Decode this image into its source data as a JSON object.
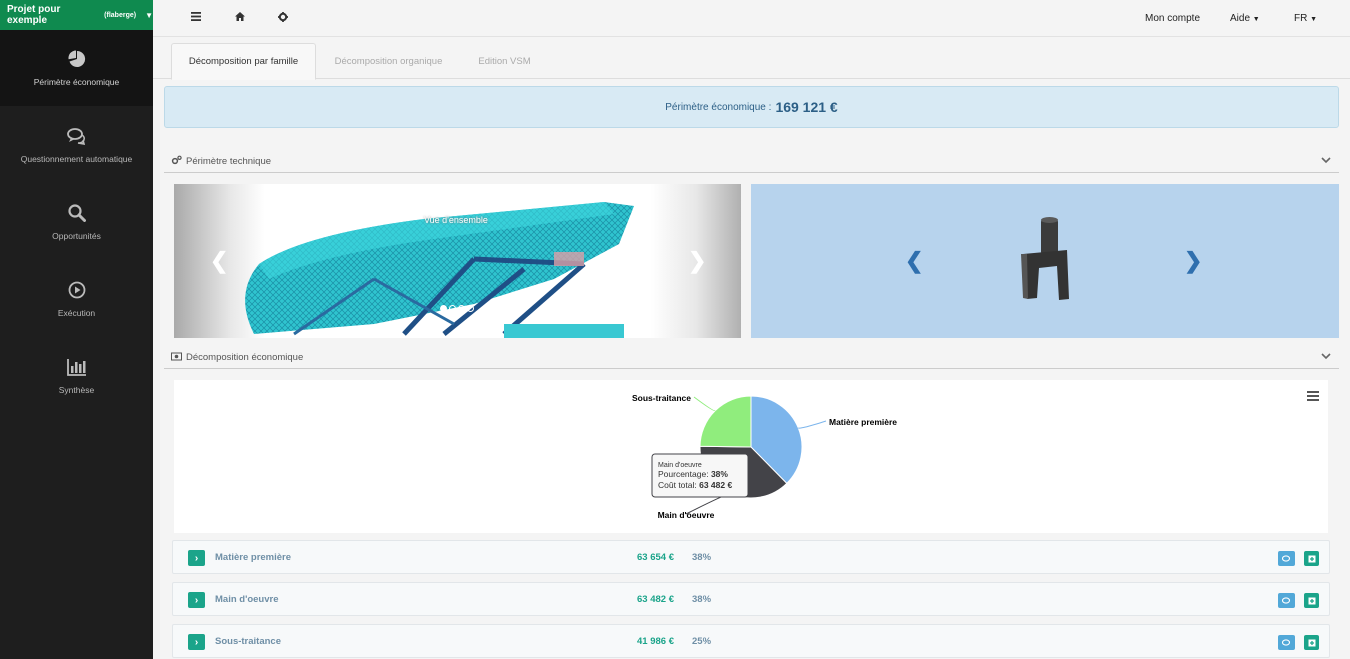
{
  "sidebar": {
    "project_name": "Projet pour exemple",
    "project_tag": "(flaberge)",
    "items": [
      {
        "label": "Périmètre économique",
        "icon": "pie-chart-icon",
        "active": true
      },
      {
        "label": "Questionnement automatique",
        "icon": "comments-icon",
        "active": false
      },
      {
        "label": "Opportunités",
        "icon": "search-icon",
        "active": false
      },
      {
        "label": "Exécution",
        "icon": "play-circle-icon",
        "active": false
      },
      {
        "label": "Synthèse",
        "icon": "bar-chart-icon",
        "active": false
      }
    ]
  },
  "topbar": {
    "menu_icon": "menu-icon",
    "home_icon": "home-icon",
    "settings_icon": "gear-icon",
    "account": "Mon compte",
    "help": "Aide",
    "language": "FR"
  },
  "tabs": [
    {
      "label": "Décomposition par famille",
      "active": true
    },
    {
      "label": "Décomposition organique",
      "active": false
    },
    {
      "label": "Edition VSM",
      "active": false
    }
  ],
  "banner": {
    "label": "Périmètre économique :",
    "amount": "169 121 €"
  },
  "technical": {
    "title": "Périmètre technique",
    "carousel1_caption": "Vue d'ensemble",
    "carousel1_slides": 4,
    "carousel1_active_slide": 1
  },
  "economic": {
    "title": "Décomposition économique"
  },
  "chart_data": {
    "type": "pie",
    "slices": [
      {
        "name": "Matière première",
        "value": 38,
        "color": "#7cb5ec"
      },
      {
        "name": "Main d'oeuvre",
        "value": 38,
        "color": "#434348"
      },
      {
        "name": "Sous-traitance",
        "value": 25,
        "color": "#90ed7d"
      }
    ],
    "tooltip": {
      "title": "Main d'oeuvre",
      "pct_label": "Pourcentage:",
      "pct_value": "38%",
      "cost_label": "Coût total:",
      "cost_value": "63 482 €"
    }
  },
  "rows": [
    {
      "name": "Matière première",
      "amount": "63 654 €",
      "pct": "38%"
    },
    {
      "name": "Main d'oeuvre",
      "amount": "63 482 €",
      "pct": "38%"
    },
    {
      "name": "Sous-traitance",
      "amount": "41 986 €",
      "pct": "25%"
    }
  ]
}
